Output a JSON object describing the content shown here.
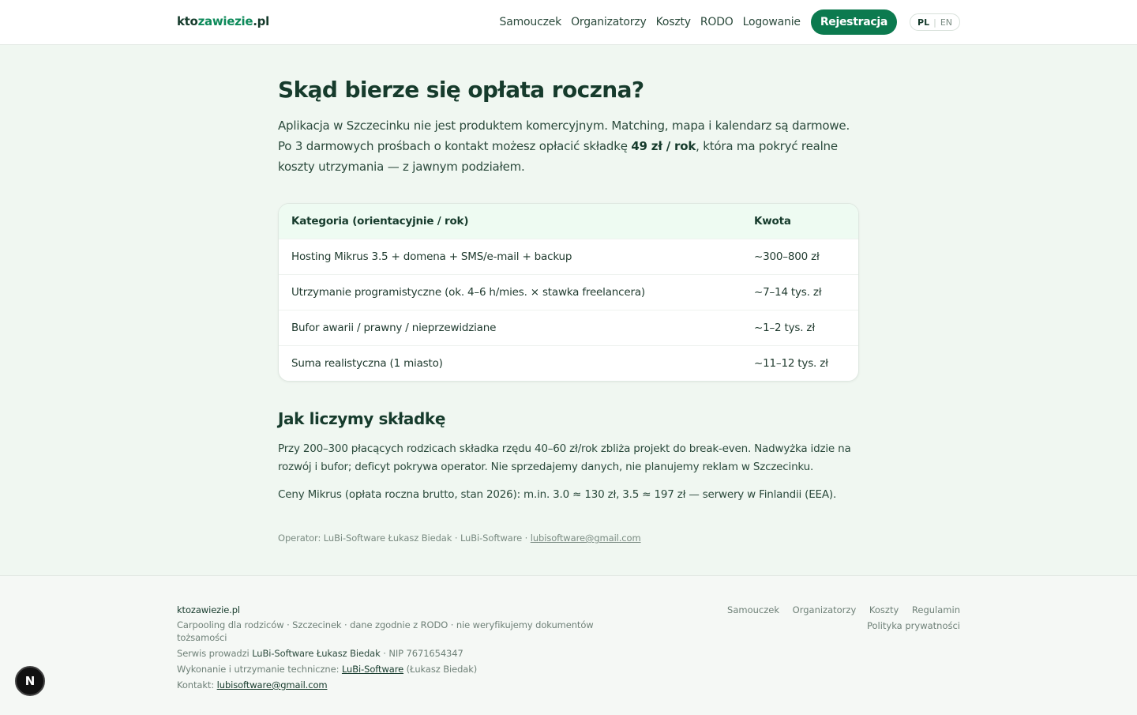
{
  "header": {
    "logo_prefix": "kto",
    "logo_accent": "zawiezie",
    "logo_suffix": ".pl",
    "nav": [
      "Samouczek",
      "Organizatorzy",
      "Koszty",
      "RODO",
      "Logowanie"
    ],
    "register_label": "Rejestracja",
    "lang_pl": "PL",
    "lang_sep": "|",
    "lang_en": "EN"
  },
  "main": {
    "title": "Skąd bierze się opłata roczna?",
    "intro_part1": "Aplikacja w Szczecinku nie jest produktem komercyjnym. Matching, mapa i kalendarz są darmowe. Po 3 darmowych prośbach o kontakt możesz opłacić składkę ",
    "intro_bold": "49 zł / rok",
    "intro_part2": ", która ma pokryć realne koszty utrzymania — z jawnym podziałem.",
    "table": {
      "headers": [
        "Kategoria (orientacyjnie / rok)",
        "Kwota"
      ],
      "rows": [
        [
          "Hosting Mikrus 3.5 + domena + SMS/e-mail + backup",
          "~300–800 zł"
        ],
        [
          "Utrzymanie programistyczne (ok. 4–6 h/mies. × stawka freelancera)",
          "~7–14 tys. zł"
        ],
        [
          "Bufor awarii / prawny / nieprzewidziane",
          "~1–2 tys. zł"
        ],
        [
          "Suma realistyczna (1 miasto)",
          "~11–12 tys. zł"
        ]
      ]
    },
    "section_title": "Jak liczymy składkę",
    "para1": "Przy 200–300 płacących rodzicach składka rzędu 40–60 zł/rok zbliża projekt do break-even. Nadwyżka idzie na rozwój i bufor; deficyt pokrywa operator. Nie sprzedajemy danych, nie planujemy reklam w Szczecinku.",
    "para2": "Ceny Mikrus (opłata roczna brutto, stan 2026): m.in. 3.0 ≈ 130 zł, 3.5 ≈ 197 zł — serwery w Finlandii (EEA).",
    "operator_text": "Operator: LuBi-Software Łukasz Biedak · LuBi-Software · ",
    "operator_email": "lubisoftware@gmail.com"
  },
  "footer": {
    "brand": "ktozawiezie.pl",
    "tagline": "Carpooling dla rodziców · Szczecinek · dane zgodnie z RODO · nie weryfikujemy dokumentów tożsamości",
    "run_by_prefix": "Serwis prowadzi ",
    "run_by_name": "LuBi-Software Łukasz Biedak",
    "run_by_nip": " · NIP 7671654347",
    "tech_prefix": "Wykonanie i utrzymanie techniczne: ",
    "tech_link": "LuBi-Software",
    "tech_suffix": " (Łukasz Biedak)",
    "contact_prefix": "Kontakt: ",
    "contact_email": "lubisoftware@gmail.com",
    "links": [
      "Samouczek",
      "Organizatorzy",
      "Koszty",
      "Regulamin"
    ],
    "privacy": "Polityka prywatności"
  },
  "dev_badge": "N"
}
